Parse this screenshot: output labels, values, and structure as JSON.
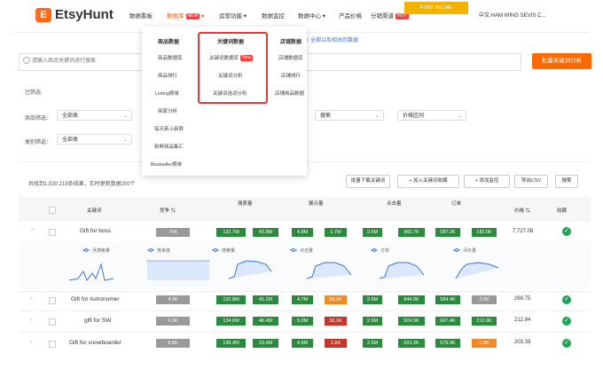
{
  "nav": {
    "logo": "EtsyHunt",
    "items": [
      {
        "label": "数据看板"
      },
      {
        "label": "数据库",
        "badge": "NEW"
      },
      {
        "label": "运营功能"
      },
      {
        "label": "数据监控"
      },
      {
        "label": "数据中心"
      },
      {
        "label": "产品价格"
      },
      {
        "label": "分销渠道",
        "badge": "HOT"
      }
    ],
    "promo": "FIND NICHE",
    "user": "中文 HAM WING SEVIS C..."
  },
  "link_text": "10: 全部以及相关的数据",
  "search": {
    "placeholder": "请输入商品关键词进行搜索"
  },
  "bulk_button": "批量关键词分析",
  "filters": {
    "section_title": "已筛选:",
    "row1_label": "商品筛选：",
    "row1_value": "全部类",
    "row2_label": "类别筛选：",
    "row2_value": "全部类",
    "right_sel1": "搜索",
    "right_sel2": "价格区间"
  },
  "dropdown": {
    "col1": {
      "title": "商品数据",
      "items": [
        "商品数据库",
        "商品排行",
        "Listing榜单",
        "商家分析",
        "每天新上新款",
        "新鲜商品集汇",
        "Bestseller榜单"
      ]
    },
    "col2": {
      "title": "关键词数据",
      "items": [
        "关键词数据库",
        "关键词分析",
        "关键词选词分析"
      ],
      "badge": "New"
    },
    "col3": {
      "title": "店铺数据",
      "items": [
        "店铺数据库",
        "店铺排行",
        "店铺商品数据"
      ]
    }
  },
  "table_info": "共找到1,530,219条结果，实时更新数据200个",
  "toolbar": [
    "批量下载关键词",
    "加入关键词收藏",
    "添加监控",
    "导出CSV",
    "搜索"
  ],
  "headers": [
    "关键词",
    "竞争",
    "搜索量",
    "展示量",
    "点击量",
    "订单",
    "评价量",
    "价格",
    "收藏"
  ],
  "rows": [
    {
      "keyword": "Gift for boss",
      "comp": "764",
      "c1": "132.7M",
      "c2": "43.8M",
      "c3": "4.8M",
      "c4": "1.7M",
      "c5": "2.5M",
      "c6": "960.7K",
      "c7": "587.2K",
      "c8": "182.0K",
      "price": "7,727.08"
    },
    {
      "keyword": "Gift for Astronomer",
      "comp": "4.3K",
      "c1": "132.8M",
      "c2": "41.2M",
      "c3": "4.7M",
      "c4": "50.5K",
      "c5": "2.5M",
      "c6": "944.9K",
      "c7": "584.4K",
      "c8": "3.5K",
      "price": "269.75"
    },
    {
      "keyword": "gift for SW",
      "comp": "6.3K",
      "c1": "134.6M",
      "c2": "48.4M",
      "c3": "5.0M",
      "c4": "32.1K",
      "c5": "2.5M",
      "c6": "924.5K",
      "c7": "607.4K",
      "c8": "212.6K",
      "price": "212.94"
    },
    {
      "keyword": "Gift for snowboarder",
      "comp": "6.8K",
      "c1": "138.4M",
      "c2": "19.4M",
      "c3": "4.8M",
      "c4": "1.6K",
      "c5": "2.5M",
      "c6": "923.2K",
      "c7": "579.9K",
      "c8": "1.8K",
      "price": "203.39"
    }
  ],
  "trend_labels": [
    "月搜索量",
    "竞争度",
    "搜索量",
    "点击量",
    "订单",
    "评价量"
  ]
}
